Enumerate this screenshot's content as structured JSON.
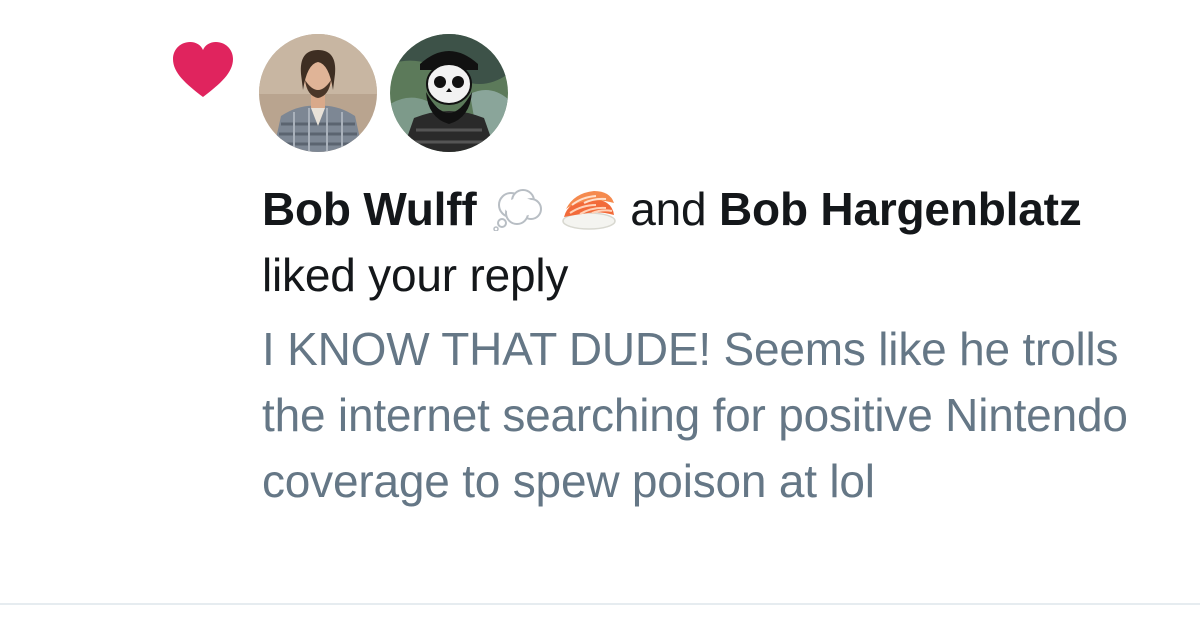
{
  "notification": {
    "icon": "heart-icon",
    "accent_color": "#e0245e",
    "users": [
      {
        "name": "Bob Wulff",
        "avatar": "avatar-photo",
        "emoji": [
          "thought-balloon-icon",
          "sushi-icon"
        ]
      },
      {
        "name": "Bob Hargenblatz",
        "avatar": "avatar-skull-beard"
      }
    ],
    "connector": "and",
    "action_text": "liked your reply",
    "reply_text": "I KNOW THAT DUDE! Seems like he trolls the internet searching for positive Nintendo coverage to spew poison at lol",
    "text_color": "#14171a",
    "secondary_text_color": "#657786"
  }
}
